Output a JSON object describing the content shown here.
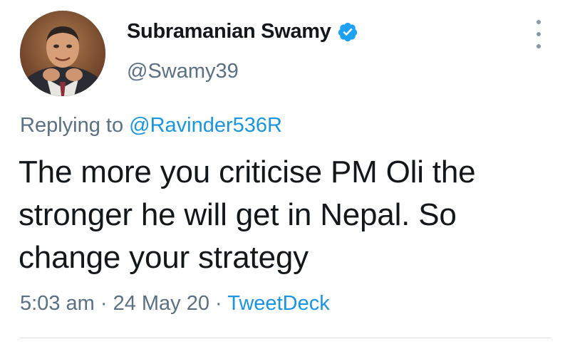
{
  "author": {
    "display_name": "Subramanian Swamy",
    "handle": "@Swamy39",
    "verified": true
  },
  "reply": {
    "prefix": "Replying to ",
    "mention": "@Ravinder536R"
  },
  "tweet": {
    "text": "The more you criticise PM Oli the stronger he will get in Nepal. So change your strategy"
  },
  "meta": {
    "time": "5:03 am",
    "separator": " · ",
    "date": "24 May 20",
    "source": "TweetDeck"
  },
  "icons": {
    "verified": "verified-badge-icon",
    "more": "more-options-icon"
  },
  "colors": {
    "text": "#14171a",
    "secondary": "#5b7083",
    "link": "#1b95e0",
    "verified": "#1da1f2",
    "divider": "#d9dfe4"
  }
}
